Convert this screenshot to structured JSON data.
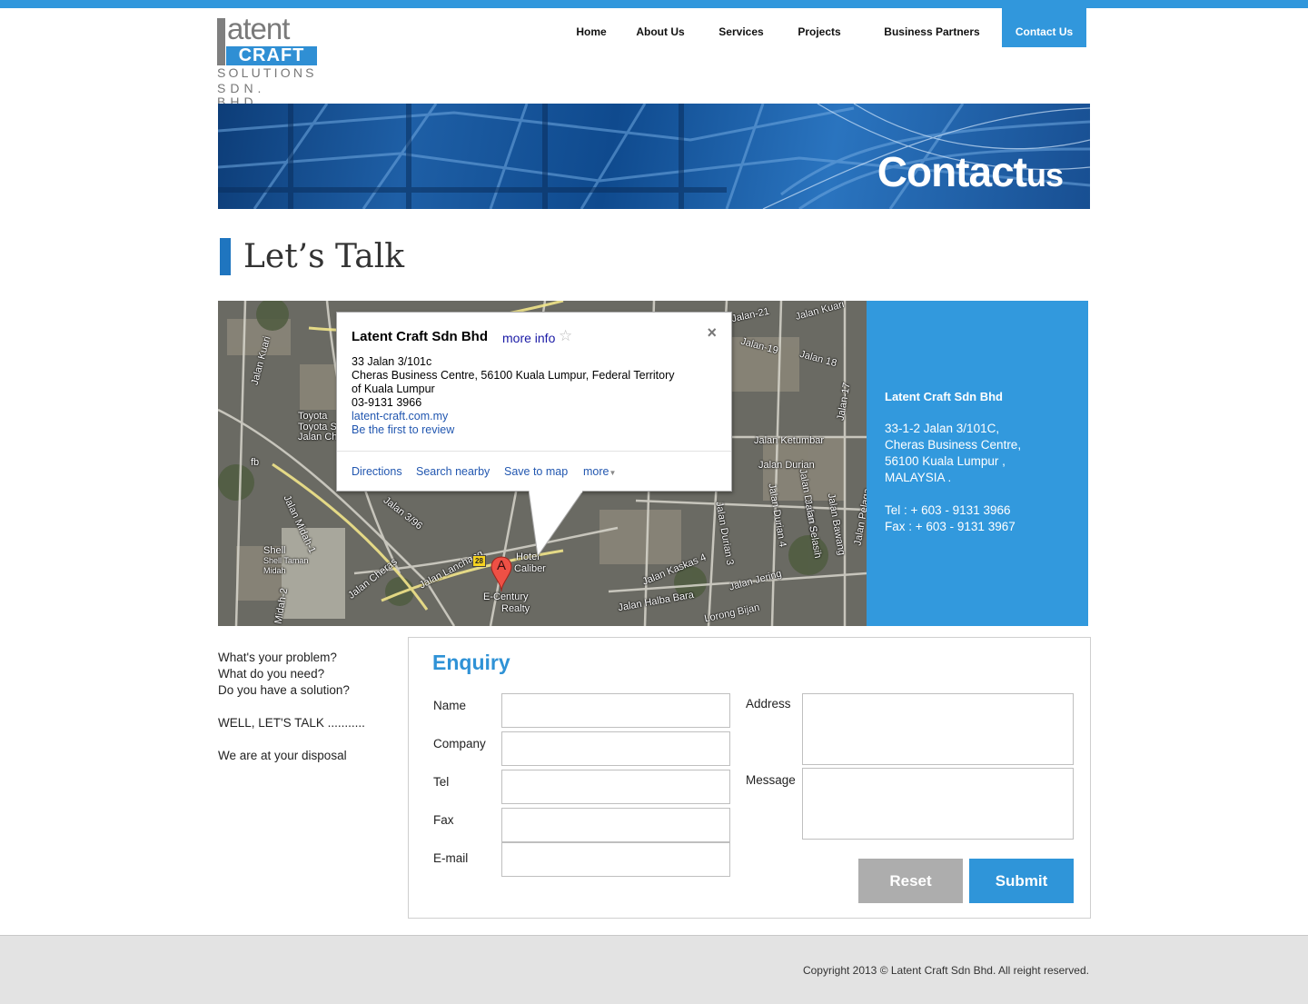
{
  "brand": {
    "logo_word1": "atent",
    "logo_word2": "CRAFT",
    "logo_word3": "SOLUTIONS",
    "logo_word4": "SDN. BHD.",
    "accent_color": "#3197dc"
  },
  "nav": {
    "items": [
      {
        "label": "Home"
      },
      {
        "label": "About Us"
      },
      {
        "label": "Services"
      },
      {
        "label": "Projects"
      },
      {
        "label": "Business Partners"
      },
      {
        "label": "Contact Us",
        "active": true
      }
    ]
  },
  "banner": {
    "title_main": "Contact",
    "title_small": "us"
  },
  "page": {
    "heading": "Let’s Talk"
  },
  "map": {
    "popup": {
      "title": "Latent Craft Sdn Bhd",
      "more_info": "more info",
      "star": "☆",
      "close": "×",
      "address_line1": "33 Jalan 3/101c",
      "address_line2": "Cheras Business Centre, 56100 Kuala Lumpur, Federal Territory",
      "address_line3": "of Kuala Lumpur",
      "phone": "03-9131 3966",
      "website": "latent-craft.com.my",
      "review": "Be the first to review",
      "actions": [
        "Directions",
        "Search nearby",
        "Save to map",
        "more"
      ]
    },
    "marker_letter": "A",
    "route_number": "28",
    "labels": [
      "Jalan Kuari",
      "Jalan-21",
      "Jalan-19",
      "Jalan 18",
      "Jalan-17",
      "Toyota",
      "Toyota Se",
      "Jalan Che",
      "fb",
      "Jalan Midah-1",
      "Jalan 3/96",
      "Jalan Cheras",
      "Jalan Lanchang",
      "Shell",
      "Shell Taman",
      "Midah",
      "Midah-2",
      "Hotel",
      "Caliber",
      "E-Century",
      "Realty",
      "Jalan Ketumbar",
      "Jalan Durian",
      "Jalan Durian 3",
      "Jalan Durian 4",
      "Jalan Durian 5",
      "Jalan Kaskas 4",
      "Jalan Halba Bara",
      "Jalan Jering",
      "Lorong Bijan",
      "Jalan Pelaga",
      "Jalan Bawang",
      "Jalan Selasih",
      "Jalan Kuari"
    ]
  },
  "info": {
    "name": "Latent Craft Sdn Bhd",
    "address_lines": [
      "33-1-2 Jalan 3/101C,",
      "Cheras Business Centre,",
      "56100 Kuala Lumpur ,",
      "MALAYSIA ."
    ],
    "tel": "Tel : + 603 - 9131 3966",
    "fax": "Fax : + 603 - 9131 3967"
  },
  "intro": {
    "lines": [
      "What's your problem?",
      "What do you need?",
      "Do you have a solution?"
    ],
    "line4": "WELL, LET'S TALK ...........",
    "line5": "We are at your disposal"
  },
  "enquiry": {
    "title": "Enquiry",
    "fields": {
      "name": "Name",
      "company": "Company",
      "tel": "Tel",
      "fax": "Fax",
      "email": "E-mail",
      "address": "Address",
      "message": "Message"
    },
    "reset_label": "Reset",
    "submit_label": "Submit"
  },
  "footer": {
    "copyright": "Copyright 2013 © Latent Craft Sdn Bhd. All reight reserved."
  }
}
